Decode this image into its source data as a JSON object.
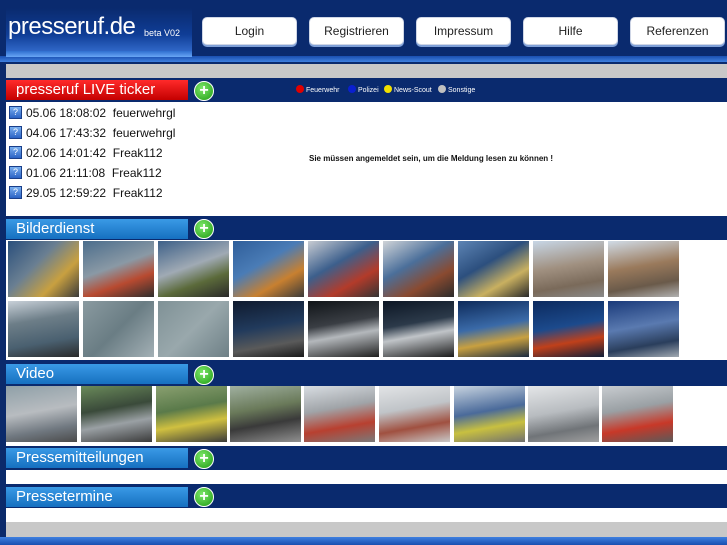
{
  "header": {
    "logo": "presseruf.de",
    "version": "beta V02",
    "nav": [
      {
        "label": "Login"
      },
      {
        "label": "Registrieren"
      },
      {
        "label": "Impressum"
      },
      {
        "label": "Hilfe"
      },
      {
        "label": "Referenzen"
      }
    ]
  },
  "ticker": {
    "title": "presseruf LIVE ticker",
    "legend": [
      {
        "label": "Feuerwehr",
        "color": "#e00000"
      },
      {
        "label": "Polizei",
        "color": "#0a1fd0"
      },
      {
        "label": "News-Scout",
        "color": "#f2e000"
      },
      {
        "label": "Sonstige",
        "color": "#c0c0c0"
      }
    ],
    "items": [
      {
        "date": "05.06 18:08:02",
        "user": "feuerwehrgl"
      },
      {
        "date": "04.06 17:43:32",
        "user": "feuerwehrgl"
      },
      {
        "date": "02.06 14:01:42",
        "user": "Freak112"
      },
      {
        "date": "01.06 21:11:08",
        "user": "Freak112"
      },
      {
        "date": "29.05 12:59:22",
        "user": "Freak112"
      }
    ],
    "message": "Sie müssen angemeldet sein, um die Meldung lesen zu können !"
  },
  "sections": {
    "bilder": {
      "title": "Bilderdienst"
    },
    "video": {
      "title": "Video"
    },
    "presse": {
      "title": "Pressemitteilungen"
    },
    "termine": {
      "title": "Pressetermine"
    }
  },
  "colors": {
    "header_bg": "#0a2a6e",
    "ticker_red": "#e00000",
    "section_blue": "#1670c0",
    "plus_green": "#1d9a12"
  },
  "icons": {
    "plus": "plus-icon",
    "info": "question-icon"
  }
}
